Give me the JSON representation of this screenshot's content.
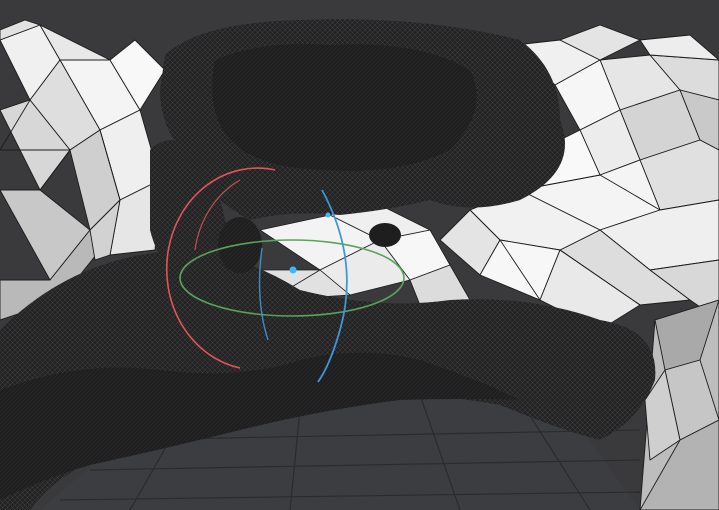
{
  "viewport": {
    "mode": "3d-mesh-wireframe-view",
    "background_color": "#3a3a3c",
    "floor_color": "#3c3d40",
    "floor_grid_color": "#2a2b2d",
    "mesh_fill_color": "#f2f2f2",
    "mesh_edge_color": "#1c1c1c",
    "dense_mesh_color": "#262627"
  },
  "gizmo": {
    "type": "rotation-gizmo",
    "x_axis_color": "#e05555",
    "y_axis_color": "#5aa35a",
    "z_axis_color": "#3f97d6",
    "handle_color": "#39b8ff"
  }
}
